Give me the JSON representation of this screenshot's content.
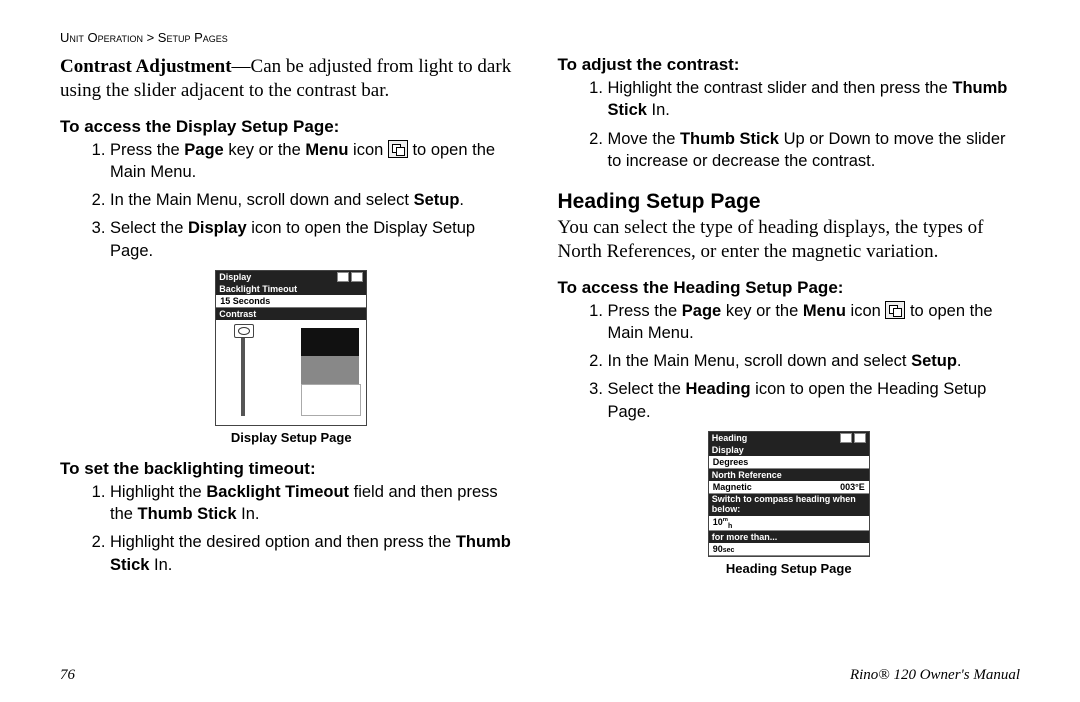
{
  "header": {
    "breadcrumb_a": "Unit Operation",
    "breadcrumb_sep": " > ",
    "breadcrumb_b": "Setup Pages"
  },
  "left": {
    "intro_bold": "Contrast Adjustment",
    "intro_rest": "—Can be adjusted from light to dark using the slider adjacent to the contrast bar.",
    "h1": "To access the Display Setup Page:",
    "s1_a": "Press the ",
    "s1_page": "Page",
    "s1_b": " key or the ",
    "s1_menu": "Menu",
    "s1_c": " icon ",
    "s1_d": " to open the Main Menu.",
    "s2_a": "In the Main Menu, scroll down and select ",
    "s2_setup": "Setup",
    "s2_b": ".",
    "s3_a": "Select the ",
    "s3_disp": "Display",
    "s3_b": " icon to open the Display Setup Page.",
    "fig": {
      "title": "Display",
      "backlight_label": "Backlight Timeout",
      "backlight_val": "15 Seconds",
      "contrast_label": "Contrast",
      "caption": "Display Setup Page"
    },
    "h2": "To set the backlighting timeout:",
    "b1_a": "Highlight the ",
    "b1_field": "Backlight Timeout",
    "b1_b": " field and then press the ",
    "b1_thumb": "Thumb Stick",
    "b1_c": " In.",
    "b2_a": "Highlight the desired option and then press the ",
    "b2_thumb": "Thumb Stick",
    "b2_b": " In."
  },
  "right": {
    "h1": "To adjust the contrast:",
    "c1_a": "Highlight the contrast slider and then press the ",
    "c1_thumb": "Thumb Stick",
    "c1_b": " In.",
    "c2_a": "Move the ",
    "c2_thumb": "Thumb Stick",
    "c2_b": " Up or Down to move the slider to increase or decrease the contrast.",
    "heading_title": "Heading Setup Page",
    "heading_body": "You can select the type of heading displays, the types of North References, or enter the magnetic variation.",
    "h2": "To access the Heading Setup Page:",
    "d1_a": "Press the ",
    "d1_page": "Page",
    "d1_b": " key or the ",
    "d1_menu": "Menu",
    "d1_c": " icon ",
    "d1_d": " to open the Main Menu.",
    "d2_a": "In the Main Menu, scroll down and select ",
    "d2_setup": "Setup",
    "d2_b": ".",
    "d3_a": "Select the ",
    "d3_head": "Heading",
    "d3_b": " icon to open the Heading Setup Page.",
    "fig": {
      "title": "Heading",
      "r1h": "Display",
      "r1v": "Degrees",
      "r2h": "North Reference",
      "r2va": "Magnetic",
      "r2vb": "003°E",
      "r3h": "Switch to compass heading when below:",
      "r3v": "10法",
      "r4h": "for more than...",
      "r4v": "90sec",
      "r3v_disp": "10",
      "r4v_disp": "90",
      "r4v_unit": "sec",
      "caption": "Heading Setup Page"
    }
  },
  "footer": {
    "page": "76",
    "manual": "Rino® 120 Owner's Manual"
  }
}
